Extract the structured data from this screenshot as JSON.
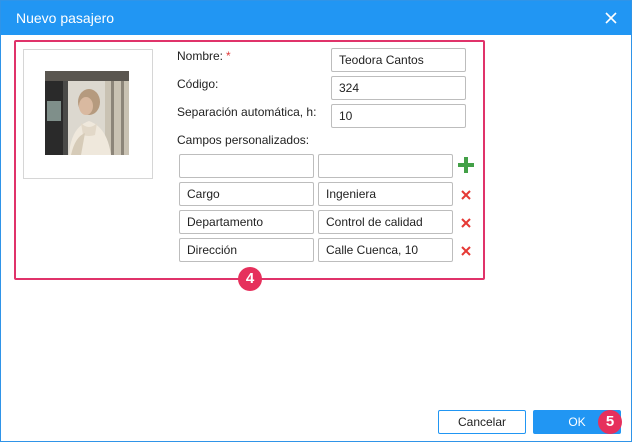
{
  "dialog": {
    "title": "Nuevo pasajero",
    "close_icon": "close-icon"
  },
  "form": {
    "name_label": "Nombre:",
    "required_mark": "*",
    "name_value": "Teodora Cantos",
    "code_label": "Código:",
    "code_value": "324",
    "separation_label": "Separación automática, h:",
    "separation_value": "10",
    "custom_fields_label": "Campos personalizados:",
    "new_field": {
      "key": "",
      "value": ""
    },
    "custom_fields": [
      {
        "key": "Cargo",
        "value": "Ingeniera"
      },
      {
        "key": "Departamento",
        "value": "Control de calidad"
      },
      {
        "key": "Dirección",
        "value": "Calle Cuenca, 10"
      }
    ]
  },
  "buttons": {
    "cancel_label": "Cancelar",
    "ok_label": "OK"
  },
  "annotations": {
    "badge_4": "4",
    "badge_5": "5"
  },
  "colors": {
    "accent": "#2196f3",
    "highlight": "#e0336a",
    "add": "#43a047",
    "delete": "#e53935"
  }
}
